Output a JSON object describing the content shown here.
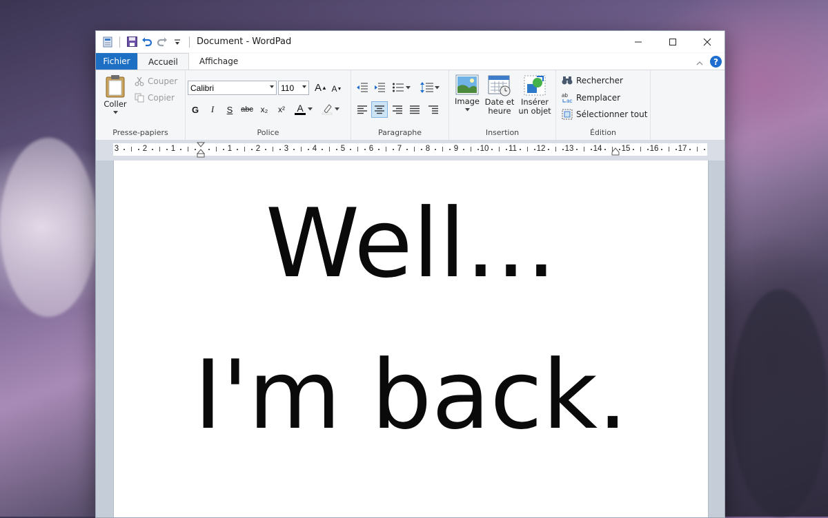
{
  "window": {
    "title": "Document - WordPad",
    "controls": {
      "minimize": "—",
      "maximize": "☐",
      "close": "✕"
    }
  },
  "tabs": {
    "file": "Fichier",
    "home": "Accueil",
    "view": "Affichage"
  },
  "ribbon": {
    "clipboard": {
      "paste": "Coller",
      "cut": "Couper",
      "copy": "Copier",
      "label": "Presse-papiers"
    },
    "font": {
      "family": "Calibri",
      "size": "110",
      "bold": "G",
      "italic": "I",
      "underline": "S",
      "strikethrough": "abc",
      "subscript": "x₂",
      "superscript": "x²",
      "font_color": "A",
      "label": "Police"
    },
    "paragraph": {
      "label": "Paragraphe"
    },
    "insert": {
      "image": "Image",
      "date_time_1": "Date et",
      "date_time_2": "heure",
      "object_1": "Insérer",
      "object_2": "un objet",
      "label": "Insertion"
    },
    "editing": {
      "find": "Rechercher",
      "replace": "Remplacer",
      "select_all": "Sélectionner tout",
      "label": "Édition"
    }
  },
  "ruler": {
    "labels": [
      "3",
      "2",
      "1",
      "",
      "1",
      "2",
      "3",
      "4",
      "5",
      "6",
      "7",
      "8",
      "9",
      "10",
      "11",
      "12",
      "13",
      "14",
      "15",
      "16",
      "17"
    ]
  },
  "document": {
    "line1": "Well...",
    "line2": "I'm back."
  },
  "colors": {
    "accent": "#1d6fc4",
    "font_color_underline": "#000000",
    "highlight": "#ffffff"
  }
}
